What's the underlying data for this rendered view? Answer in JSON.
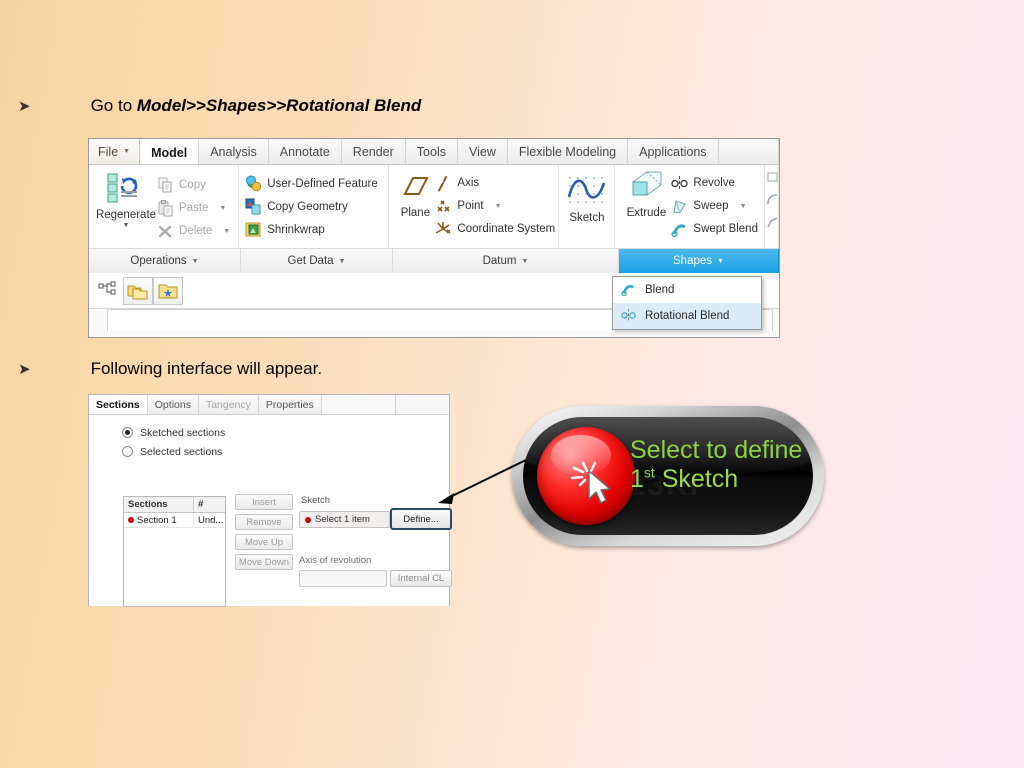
{
  "slide": {
    "bullets": [
      {
        "marker": "➤",
        "prefix": "Go to ",
        "emphasis": "Model>>Shapes>>Rotational Blend"
      },
      {
        "marker": "➤",
        "prefix": "Following interface will appear.",
        "emphasis": ""
      }
    ]
  },
  "ribbon": {
    "file_tab": "File",
    "tabs": [
      "Model",
      "Analysis",
      "Annotate",
      "Render",
      "Tools",
      "View",
      "Flexible Modeling",
      "Applications"
    ],
    "active_tab": "Model",
    "groups": {
      "operations": {
        "title": "Operations",
        "big_button": "Regenerate",
        "items": [
          "Copy",
          "Paste",
          "Delete"
        ]
      },
      "get_data": {
        "title": "Get Data",
        "items": [
          "User-Defined Feature",
          "Copy Geometry",
          "Shrinkwrap"
        ]
      },
      "datum": {
        "title": "Datum",
        "big_button": "Plane",
        "items": [
          "Axis",
          "Point",
          "Coordinate System"
        ]
      },
      "sketch": {
        "label": "Sketch"
      },
      "shapes": {
        "title": "Shapes",
        "big_button": "Extrude",
        "items": [
          "Revolve",
          "Sweep",
          "Swept Blend"
        ]
      }
    },
    "shapes_menu": {
      "items": [
        "Blend",
        "Rotational Blend"
      ],
      "highlighted": "Rotational Blend"
    },
    "selected_group_color": "#19a3e8",
    "menu_highlight_color": "#d9ecf7"
  },
  "dialog": {
    "tabs": [
      "Sections",
      "Options",
      "Tangency",
      "Properties"
    ],
    "active_tab": "Sections",
    "disabled_tab": "Tangency",
    "radios": [
      {
        "label": "Sketched sections",
        "selected": true
      },
      {
        "label": "Selected sections",
        "selected": false
      }
    ],
    "table": {
      "headers": [
        "Sections",
        "#"
      ],
      "rows": [
        [
          "Section 1",
          "Und..."
        ]
      ]
    },
    "buttons": [
      "Insert",
      "Remove",
      "Move Up",
      "Move Down"
    ],
    "sketch_label": "Sketch",
    "select_field_value": "Select 1 item",
    "define_button": "Define...",
    "axis_label": "Axis of revolution",
    "axis_field_value": "",
    "internal_cl_button": "Internal CL",
    "define_highlight_color": "#2a4a66",
    "error_dot_color": "#d00000"
  },
  "callout": {
    "line1": "Select to define",
    "line2_number": "1",
    "line2_sup": "st",
    "line2_rest": " Sketch",
    "watermark": "123RF",
    "text_color": "#8cd241",
    "knob_color": "#e00000"
  }
}
